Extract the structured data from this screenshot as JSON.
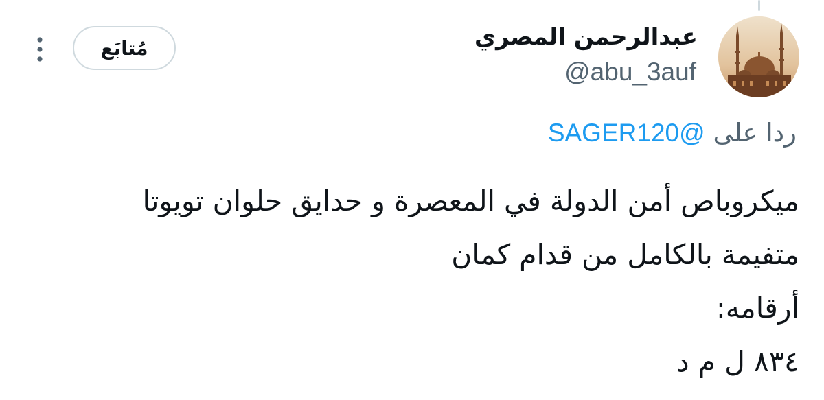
{
  "author": {
    "display_name": "عبدالرحمن المصري",
    "handle": "@abu_3auf"
  },
  "follow_button_label": "مُتابَع",
  "reply_context": {
    "prefix": "ردا على",
    "mention": "@SAGER120"
  },
  "tweet_lines": [
    "ميكروباص أمن الدولة في المعصرة و حدايق حلوان تويوتا",
    "متفيمة بالكامل من قدام كمان",
    "أرقامه:",
    "٨٣٤ ل م د"
  ],
  "icons": {
    "more": "more-vertical-icon"
  },
  "colors": {
    "text": "#0f1419",
    "secondary": "#536471",
    "link": "#1d9bf0",
    "border": "#cfd9de"
  }
}
